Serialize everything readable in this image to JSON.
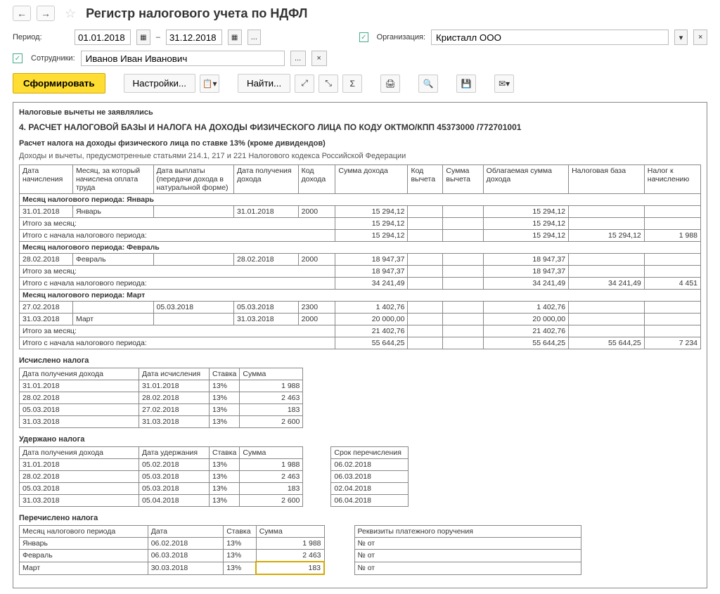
{
  "header": {
    "title": "Регистр налогового учета по НДФЛ"
  },
  "filter": {
    "period_label": "Период:",
    "date_from": "01.01.2018",
    "date_sep": "–",
    "date_to": "31.12.2018",
    "dots": "...",
    "org_label": "Организация:",
    "org_value": "Кристалл ООО",
    "emp_label": "Сотрудники:",
    "emp_value": "Иванов Иван Иванович"
  },
  "toolbar": {
    "form": "Сформировать",
    "settings": "Настройки...",
    "find": "Найти..."
  },
  "report": {
    "deductions_none": "Налоговые вычеты не заявлялись",
    "section4_title": "4. РАСЧЕТ НАЛОГОВОЙ БАЗЫ И НАЛОГА НА ДОХОДЫ ФИЗИЧЕСКОГО ЛИЦА ПО КОДУ ОКТМО/КПП 45373000   /772701001",
    "calc_subtitle": "Расчет налога на доходы физического лица по ставке 13% (кроме дивидендов)",
    "articles_note": "Доходы и вычеты, предусмотренные статьями 214.1, 217 и 221 Налогового кодекса Российской Федерации",
    "main_headers": [
      "Дата начисления",
      "Месяц, за который начислена оплата труда",
      "Дата выплаты (передачи дохода в натуральной форме)",
      "Дата получения дохода",
      "Код дохода",
      "Сумма дохода",
      "Код вычета",
      "Сумма вычета",
      "Облагаемая сумма дохода",
      "Налоговая база",
      "Налог к начислению"
    ],
    "jan_head": "Месяц налогового периода: Январь",
    "jan_row": [
      "31.01.2018",
      "Январь",
      "",
      "31.01.2018",
      "2000",
      "15 294,12",
      "",
      "",
      "15 294,12",
      "",
      ""
    ],
    "jan_month": [
      "Итого за месяц:",
      "",
      "",
      "",
      "",
      "15 294,12",
      "",
      "",
      "15 294,12",
      "",
      ""
    ],
    "jan_total": [
      "Итого с начала налогового периода:",
      "",
      "",
      "",
      "",
      "15 294,12",
      "",
      "",
      "15 294,12",
      "15 294,12",
      "1 988"
    ],
    "feb_head": "Месяц налогового периода: Февраль",
    "feb_row": [
      "28.02.2018",
      "Февраль",
      "",
      "28.02.2018",
      "2000",
      "18 947,37",
      "",
      "",
      "18 947,37",
      "",
      ""
    ],
    "feb_month": [
      "Итого за месяц:",
      "",
      "",
      "",
      "",
      "18 947,37",
      "",
      "",
      "18 947,37",
      "",
      ""
    ],
    "feb_total": [
      "Итого с начала налогового периода:",
      "",
      "",
      "",
      "",
      "34 241,49",
      "",
      "",
      "34 241,49",
      "34 241,49",
      "4 451"
    ],
    "mar_head": "Месяц налогового периода: Март",
    "mar_row1": [
      "27.02.2018",
      "",
      "05.03.2018",
      "05.03.2018",
      "2300",
      "1 402,76",
      "",
      "",
      "1 402,76",
      "",
      ""
    ],
    "mar_row2": [
      "31.03.2018",
      "Март",
      "",
      "31.03.2018",
      "2000",
      "20 000,00",
      "",
      "",
      "20 000,00",
      "",
      ""
    ],
    "mar_month": [
      "Итого за месяц:",
      "",
      "",
      "",
      "",
      "21 402,76",
      "",
      "",
      "21 402,76",
      "",
      ""
    ],
    "mar_total": [
      "Итого с начала налогового периода:",
      "",
      "",
      "",
      "",
      "55 644,25",
      "",
      "",
      "55 644,25",
      "55 644,25",
      "7 234"
    ],
    "calc_title": "Исчислено налога",
    "calc_headers": [
      "Дата получения дохода",
      "Дата исчисления",
      "Ставка",
      "Сумма"
    ],
    "calc_rows": [
      [
        "31.01.2018",
        "31.01.2018",
        "13%",
        "1 988"
      ],
      [
        "28.02.2018",
        "28.02.2018",
        "13%",
        "2 463"
      ],
      [
        "05.03.2018",
        "27.02.2018",
        "13%",
        "183"
      ],
      [
        "31.03.2018",
        "31.03.2018",
        "13%",
        "2 600"
      ]
    ],
    "hold_title": "Удержано налога",
    "hold_headers": [
      "Дата получения дохода",
      "Дата удержания",
      "Ставка",
      "Сумма",
      "",
      "Срок перечисления"
    ],
    "hold_rows": [
      [
        "31.01.2018",
        "05.02.2018",
        "13%",
        "1 988",
        "",
        "06.02.2018"
      ],
      [
        "28.02.2018",
        "05.03.2018",
        "13%",
        "2 463",
        "",
        "06.03.2018"
      ],
      [
        "05.03.2018",
        "05.03.2018",
        "13%",
        "183",
        "",
        "02.04.2018"
      ],
      [
        "31.03.2018",
        "05.04.2018",
        "13%",
        "2 600",
        "",
        "06.04.2018"
      ]
    ],
    "paid_title": "Перечислено налога",
    "paid_headers": [
      "Месяц налогового периода",
      "Дата",
      "Ставка",
      "Сумма",
      "",
      "Реквизиты платежного поручения"
    ],
    "paid_rows": [
      [
        "Январь",
        "06.02.2018",
        "13%",
        "1 988",
        "",
        "№  от"
      ],
      [
        "Февраль",
        "06.03.2018",
        "13%",
        "2 463",
        "",
        "№  от"
      ],
      [
        "Март",
        "30.03.2018",
        "13%",
        "183",
        "",
        "№  от"
      ]
    ]
  }
}
